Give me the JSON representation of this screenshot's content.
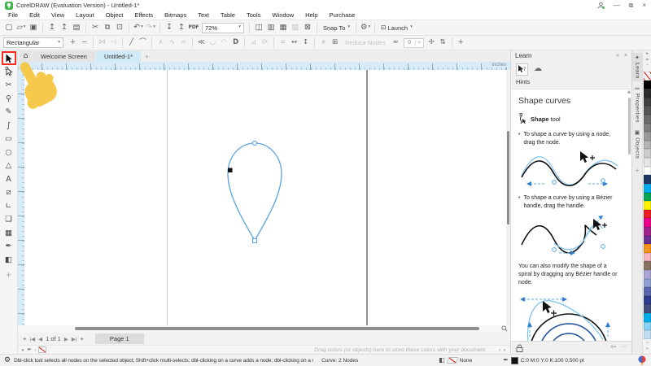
{
  "title_bar": {
    "title": "CorelDRAW (Evaluation Version) - Untitled-1*"
  },
  "window_controls": {
    "minimize": "—",
    "restore": "⧉",
    "close": "×"
  },
  "menu_bar": {
    "items": [
      "File",
      "Edit",
      "View",
      "Layout",
      "Object",
      "Effects",
      "Bitmaps",
      "Text",
      "Table",
      "Tools",
      "Window",
      "Help",
      "Purchase"
    ]
  },
  "standard_toolbar": {
    "zoom_value": "72%",
    "snap_to_label": "Snap To",
    "launch_label": "Launch",
    "items": [
      {
        "t": "ico",
        "name": "new-document-icon",
        "glyph": "▢"
      },
      {
        "t": "ico",
        "name": "open-icon",
        "glyph": "▱",
        "caret": true
      },
      {
        "t": "ico",
        "name": "save-icon",
        "glyph": "▣"
      },
      {
        "t": "sep"
      },
      {
        "t": "ico",
        "name": "open-from-cloud-icon",
        "glyph": "↥"
      },
      {
        "t": "ico",
        "name": "save-to-cloud-icon",
        "glyph": "↥"
      },
      {
        "t": "ico",
        "name": "print-icon",
        "glyph": "▤"
      },
      {
        "t": "sep"
      },
      {
        "t": "ico",
        "name": "cut-icon",
        "glyph": "✂"
      },
      {
        "t": "ico",
        "name": "copy-icon",
        "glyph": "⧉"
      },
      {
        "t": "ico",
        "name": "paste-icon",
        "glyph": "⊡"
      },
      {
        "t": "sep"
      },
      {
        "t": "ico",
        "name": "undo-icon",
        "glyph": "↶",
        "caret": true
      },
      {
        "t": "ico",
        "name": "redo-icon",
        "glyph": "↷",
        "caret": true,
        "disabled": true
      },
      {
        "t": "sep"
      },
      {
        "t": "ico",
        "name": "import-icon",
        "glyph": "↧"
      },
      {
        "t": "ico",
        "name": "export-icon",
        "glyph": "↥"
      },
      {
        "t": "ico",
        "name": "publish-to-pdf-icon",
        "glyph": "PDF",
        "text": true
      },
      {
        "t": "zoom"
      },
      {
        "t": "sep"
      },
      {
        "t": "ico",
        "name": "full-screen-preview-icon",
        "glyph": "◫"
      },
      {
        "t": "ico",
        "name": "show-rulers-icon",
        "glyph": "▥"
      },
      {
        "t": "ico",
        "name": "show-grid-icon",
        "glyph": "▦"
      },
      {
        "t": "ico",
        "name": "show-guidelines-icon",
        "glyph": "▧",
        "disabled": true
      },
      {
        "t": "ico",
        "name": "treat-as-filled-icon",
        "glyph": "⊠"
      },
      {
        "t": "sep"
      },
      {
        "t": "snap"
      },
      {
        "t": "sep"
      },
      {
        "t": "ico",
        "name": "options-gear-icon",
        "glyph": "⚙",
        "caret": true
      },
      {
        "t": "sep"
      },
      {
        "t": "launch"
      }
    ]
  },
  "property_bar": {
    "selection_mode": "Rectangular",
    "reduce_nodes_label": "Reduce Nodes",
    "smoothness_value": "0",
    "items": [
      {
        "t": "combo"
      },
      {
        "t": "ico",
        "name": "add-node-icon",
        "glyph": "+"
      },
      {
        "t": "ico",
        "name": "delete-node-icon",
        "glyph": "−"
      },
      {
        "t": "sep"
      },
      {
        "t": "ico",
        "name": "join-nodes-icon",
        "glyph": "⋈",
        "disabled": true
      },
      {
        "t": "ico",
        "name": "break-curve-icon",
        "glyph": "⊣",
        "disabled": true
      },
      {
        "t": "sep"
      },
      {
        "t": "ico",
        "name": "convert-to-line-icon",
        "glyph": "╱"
      },
      {
        "t": "ico",
        "name": "convert-to-curve-icon",
        "glyph": "⌒"
      },
      {
        "t": "sep"
      },
      {
        "t": "ico",
        "name": "cusp-node-icon",
        "glyph": "∧",
        "disabled": true
      },
      {
        "t": "ico",
        "name": "smooth-node-icon",
        "glyph": "∿",
        "disabled": true
      },
      {
        "t": "ico",
        "name": "symmetrical-node-icon",
        "glyph": "≃",
        "disabled": true
      },
      {
        "t": "sep"
      },
      {
        "t": "ico",
        "name": "reverse-direction-icon",
        "glyph": "≪"
      },
      {
        "t": "ico",
        "name": "close-curve-icon",
        "glyph": "◡",
        "disabled": true
      },
      {
        "t": "ico",
        "name": "extract-subpath-icon",
        "glyph": "◠",
        "disabled": true
      },
      {
        "t": "ico",
        "name": "extend-curve-to-close-icon",
        "glyph": "D",
        "text": true
      },
      {
        "t": "sep"
      },
      {
        "t": "ico",
        "name": "stretch-nodes-icon",
        "glyph": "⊿",
        "disabled": true
      },
      {
        "t": "ico",
        "name": "rotate-nodes-icon",
        "glyph": "⟳",
        "disabled": true
      },
      {
        "t": "sep"
      },
      {
        "t": "ico",
        "name": "align-nodes-icon",
        "glyph": "≡",
        "disabled": true
      },
      {
        "t": "ico",
        "name": "reflect-horizontal-icon",
        "glyph": "↔"
      },
      {
        "t": "ico",
        "name": "reflect-vertical-icon",
        "glyph": "↕"
      },
      {
        "t": "sep"
      },
      {
        "t": "ico",
        "name": "elastic-mode-icon",
        "glyph": "∗",
        "disabled": true
      },
      {
        "t": "ico",
        "name": "select-all-nodes-icon",
        "glyph": "⊞"
      },
      {
        "t": "label"
      },
      {
        "t": "spin"
      },
      {
        "t": "ico",
        "name": "curve-smoothness-icon",
        "glyph": "✢"
      },
      {
        "t": "ico",
        "name": "node-sliders-icon",
        "glyph": "⇅"
      },
      {
        "t": "sep"
      },
      {
        "t": "ico",
        "name": "customize-property-bar-icon",
        "glyph": "+"
      }
    ]
  },
  "document_tabs": {
    "home_glyph": "⌂",
    "items": [
      {
        "label": "Welcome Screen",
        "active": false
      },
      {
        "label": "Untitled-1*",
        "active": true
      }
    ]
  },
  "ruler": {
    "units": "inches"
  },
  "toolbox": {
    "tools": [
      {
        "name": "pick-tool",
        "svg": "pick",
        "selected": true
      },
      {
        "name": "shape-tool",
        "svg": "shape"
      },
      {
        "name": "crop-tool",
        "glyph": "✂"
      },
      {
        "name": "zoom-tool",
        "glyph": "⚲"
      },
      {
        "name": "freehand-tool",
        "glyph": "✎"
      },
      {
        "name": "artistic-media-tool",
        "glyph": "∫"
      },
      {
        "name": "rectangle-tool",
        "glyph": "▭"
      },
      {
        "name": "ellipse-tool",
        "glyph": "○"
      },
      {
        "name": "polygon-tool",
        "glyph": "△"
      },
      {
        "name": "text-tool",
        "glyph": "A"
      },
      {
        "name": "dimension-tool",
        "glyph": "⧄"
      },
      {
        "name": "connector-tool",
        "glyph": "∟"
      },
      {
        "name": "drop-shadow-tool",
        "glyph": "❏"
      },
      {
        "name": "transparency-tool",
        "glyph": "▦"
      },
      {
        "name": "color-eyedropper-tool",
        "glyph": "✒"
      },
      {
        "name": "interactive-fill-tool",
        "glyph": "◧"
      },
      {
        "name": "add-tools-button",
        "glyph": "+",
        "add": true
      }
    ]
  },
  "canvas": {
    "shape_stroke": "#5ba3e2",
    "node_selected_color": "#111111"
  },
  "learn_panel": {
    "title": "Learn",
    "hints_label": "Hints",
    "section_title": "Shape curves",
    "tool_bold": "Shape",
    "tool_rest": " tool",
    "bullet1": "To shape a curve by using a node, drag the node.",
    "bullet2": "To shape a curve by using a Bézier handle, drag the handle.",
    "note": "You can also modify the shape of a spiral by dragging any Bézier handle or node.",
    "collapse_glyph": "»",
    "close_glyph": "×"
  },
  "docker_tabs": {
    "items": [
      {
        "label": "Learn",
        "glyph": "✦",
        "active": true
      },
      {
        "label": "Properties",
        "glyph": "≔",
        "active": false
      },
      {
        "label": "Objects",
        "glyph": "▣",
        "active": false
      }
    ]
  },
  "palette": {
    "colors": [
      "none",
      "#000000",
      "#2b2b2b",
      "#404040",
      "#555555",
      "#6b6b6b",
      "#808080",
      "#999999",
      "#b3b3b3",
      "#cccccc",
      "#e6e6e6",
      "#ffffff",
      "#1f3864",
      "#00adef",
      "#00a651",
      "#fff200",
      "#ed1c24",
      "#ec008c",
      "#a3238e",
      "#68308f",
      "#f7941e",
      "#f5b8c3",
      "#8a7263",
      "#a8a5d3",
      "#8fa0d3",
      "#5868af",
      "#2c3c8f",
      "#414f7d",
      "#00aeef",
      "#84d2f4",
      "#c0def2"
    ]
  },
  "page_controls": {
    "add_page": "+",
    "first": "|◀",
    "prev": "◀",
    "indicator": "1 of 1",
    "next": "▶",
    "last": "▶|",
    "add_page2": "+",
    "page_tab": "Page 1"
  },
  "document_palette": {
    "hint": "Drag colors (or objects) here to store these colors with your document",
    "flyout": "▸",
    "scroll_left": "‹",
    "scroll_right": "›",
    "more": "»"
  },
  "status_bar": {
    "hint": "Dbl-click tool selects all nodes on the selected object; Shift+click multi-selects; dbl-clicking on a curve adds a node; dbl-clicking on a node removes it",
    "selection_info": "Curve: 2 Nodes",
    "fill_label": "None",
    "outline_info": "C:0 M:0 Y:0 K:100  0.500 pt"
  }
}
